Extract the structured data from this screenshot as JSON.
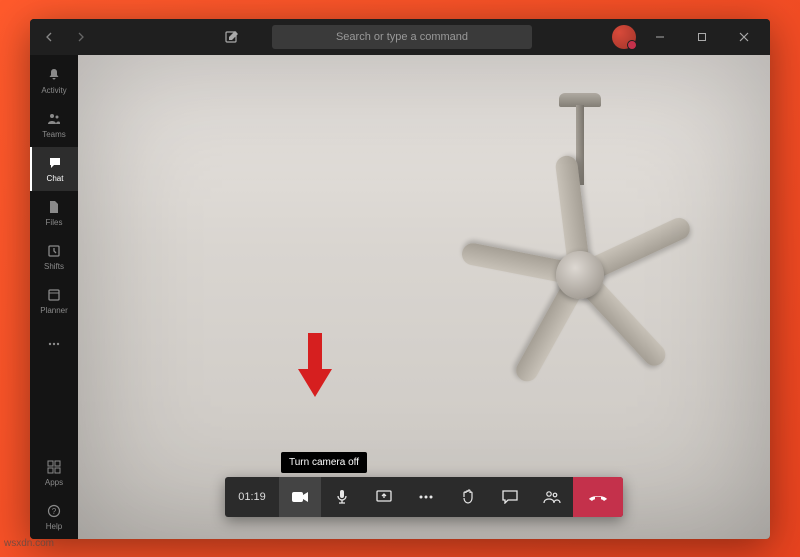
{
  "watermark": "wsxdn.com",
  "titlebar": {
    "search_placeholder": "Search or type a command"
  },
  "sidebar": {
    "items": [
      {
        "label": "Activity"
      },
      {
        "label": "Teams"
      },
      {
        "label": "Chat"
      },
      {
        "label": "Files"
      },
      {
        "label": "Shifts"
      },
      {
        "label": "Planner"
      },
      {
        "label": ""
      }
    ],
    "bottom": [
      {
        "label": "Apps"
      },
      {
        "label": "Help"
      }
    ]
  },
  "call": {
    "duration": "01:19",
    "tooltip": "Turn camera off"
  }
}
